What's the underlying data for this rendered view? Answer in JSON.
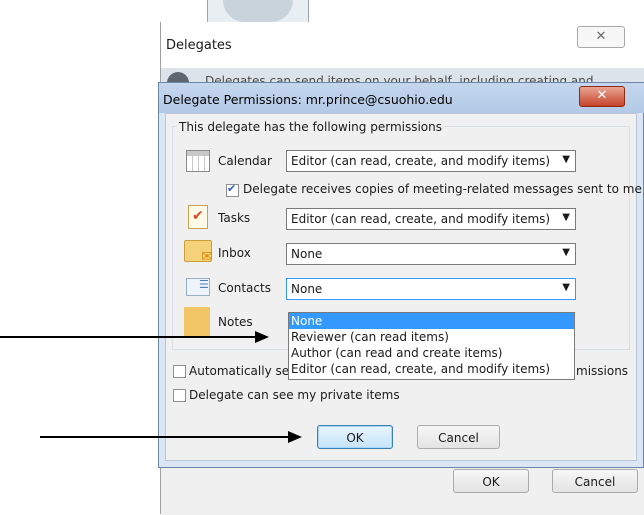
{
  "delegates_dialog": {
    "title": "Delegates",
    "info_text": "Delegates can send items on your behalf, including creating and",
    "ok_label": "OK",
    "cancel_label": "Cancel"
  },
  "permissions_dialog": {
    "title": "Delegate Permissions: mr.prince@csuohio.edu",
    "group_label": "This delegate has the following permissions",
    "calendar": {
      "label": "Calendar",
      "value": "Editor (can read, create, and modify items)"
    },
    "meeting_copies": {
      "label": "Delegate receives copies of meeting-related messages sent to me",
      "checked": true
    },
    "tasks": {
      "label": "Tasks",
      "value": "Editor (can read, create, and modify items)"
    },
    "inbox": {
      "label": "Inbox",
      "value": "None"
    },
    "contacts": {
      "label": "Contacts",
      "value": "None",
      "options": [
        "None",
        "Reviewer (can read items)",
        "Author (can read and create items)",
        "Editor (can read, create, and modify items)"
      ],
      "expanded": true
    },
    "notes": {
      "label": "Notes"
    },
    "auto_send": {
      "label_left": "Automatically sen",
      "label_right": "missions",
      "checked": false
    },
    "private_items": {
      "label": "Delegate can see my private items",
      "checked": false
    },
    "ok_label": "OK",
    "cancel_label": "Cancel"
  }
}
